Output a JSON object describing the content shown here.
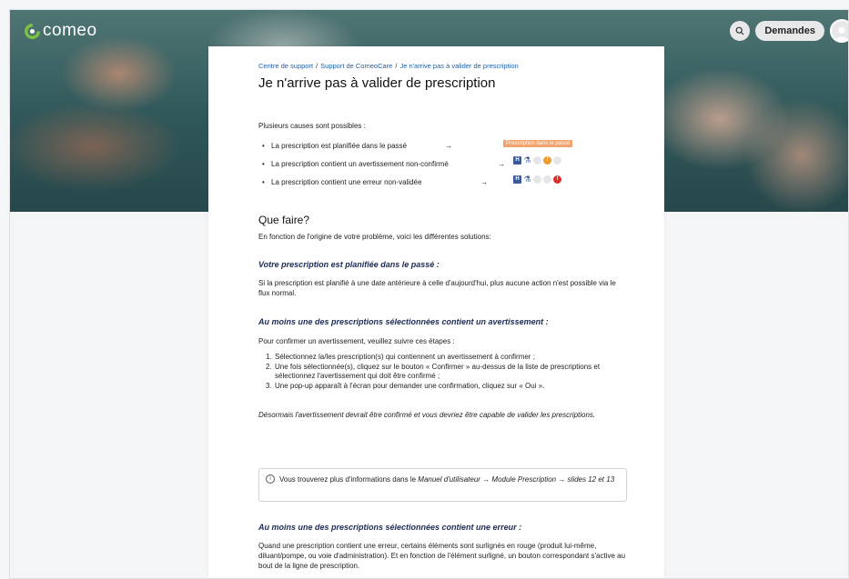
{
  "header": {
    "logo_text": "comeo",
    "demandes_label": "Demandes",
    "search_icon": "search-icon",
    "avatar_icon": "user-avatar-icon"
  },
  "colors": {
    "brand_green": "#7cc142",
    "brand_blue": "#1e5fa8",
    "heading_navy": "#1b2a55",
    "warning_orange": "#f29a2e",
    "error_red": "#d9302c",
    "action_blue": "#5b8fdc"
  },
  "breadcrumb": {
    "items": [
      "Centre de support",
      "Support de ComeoCare",
      "Je n'arrive pas à valider de prescription"
    ],
    "separator": "/"
  },
  "article": {
    "title": "Je n'arrive pas à valider de prescription",
    "intro": "Plusieurs causes sont possibles :",
    "causes": [
      {
        "text": "La prescription est planifiée dans le passé",
        "arrow": "→"
      },
      {
        "text": "La prescription contient un avertissement non-confirmé",
        "arrow": "→"
      },
      {
        "text": "La prescription contient une erreur non-validée",
        "arrow": "→"
      }
    ],
    "past_badge": "Prescription dans le passé",
    "icon_labels": {
      "h": "H",
      "warn": "!",
      "err": "!"
    },
    "que_faire_title": "Que faire?",
    "que_faire_text": "En fonction de l'origine de votre problème, voici les différentes solutions:",
    "section1": {
      "title": "Votre prescription est planifiée dans le passé :",
      "text": "Si la prescription est planifié à une date antérieure à celle d'aujourd'hui, plus aucune action n'est possible via le flux normal."
    },
    "section2": {
      "title": "Au moins une des prescriptions sélectionnées contient un avertissement :",
      "intro": "Pour confirmer un avertissement, veuillez suivre ces étapes :",
      "steps": [
        {
          "num": "1.",
          "text": "Sélectionnez la/les prescription(s) qui contiennent un avertissement à confirmer ;"
        },
        {
          "num": "2.",
          "text": "Une fois sélectionnée(s), cliquez sur le bouton « Confirmer » au-dessus de la liste de prescriptions et sélectionnez l'avertissement qui doit être confirmé ;"
        },
        {
          "num": "3.",
          "text": "Une pop-up apparaît à l'écran pour demander une confirmation, cliquez sur « Oui »."
        }
      ],
      "outro": "Désormais l'avertissement devrait être confirmé et vous devriez être capable de valider les prescriptions."
    },
    "note": {
      "info_icon": "info-icon",
      "info_glyph": "i",
      "prefix": "Vous trouverez plus d'informations dans le ",
      "reference": "Manuel d'utilisateur → Module Prescription → slides 12 et 13"
    },
    "section3": {
      "title": "Au moins une des prescriptions sélectionnées contient une erreur :",
      "text": "Quand une prescription contient une erreur, certains éléments sont surlignés en rouge (produit lui-même, diluant/pompe, ou voie d'administration). Et en fonction de l'élément surligné, un bouton correspondant s'active au bout de la ligne de prescription."
    },
    "action_icons": [
      "flask-icon",
      "drop-icon",
      "person-icon",
      "route-icon"
    ]
  }
}
